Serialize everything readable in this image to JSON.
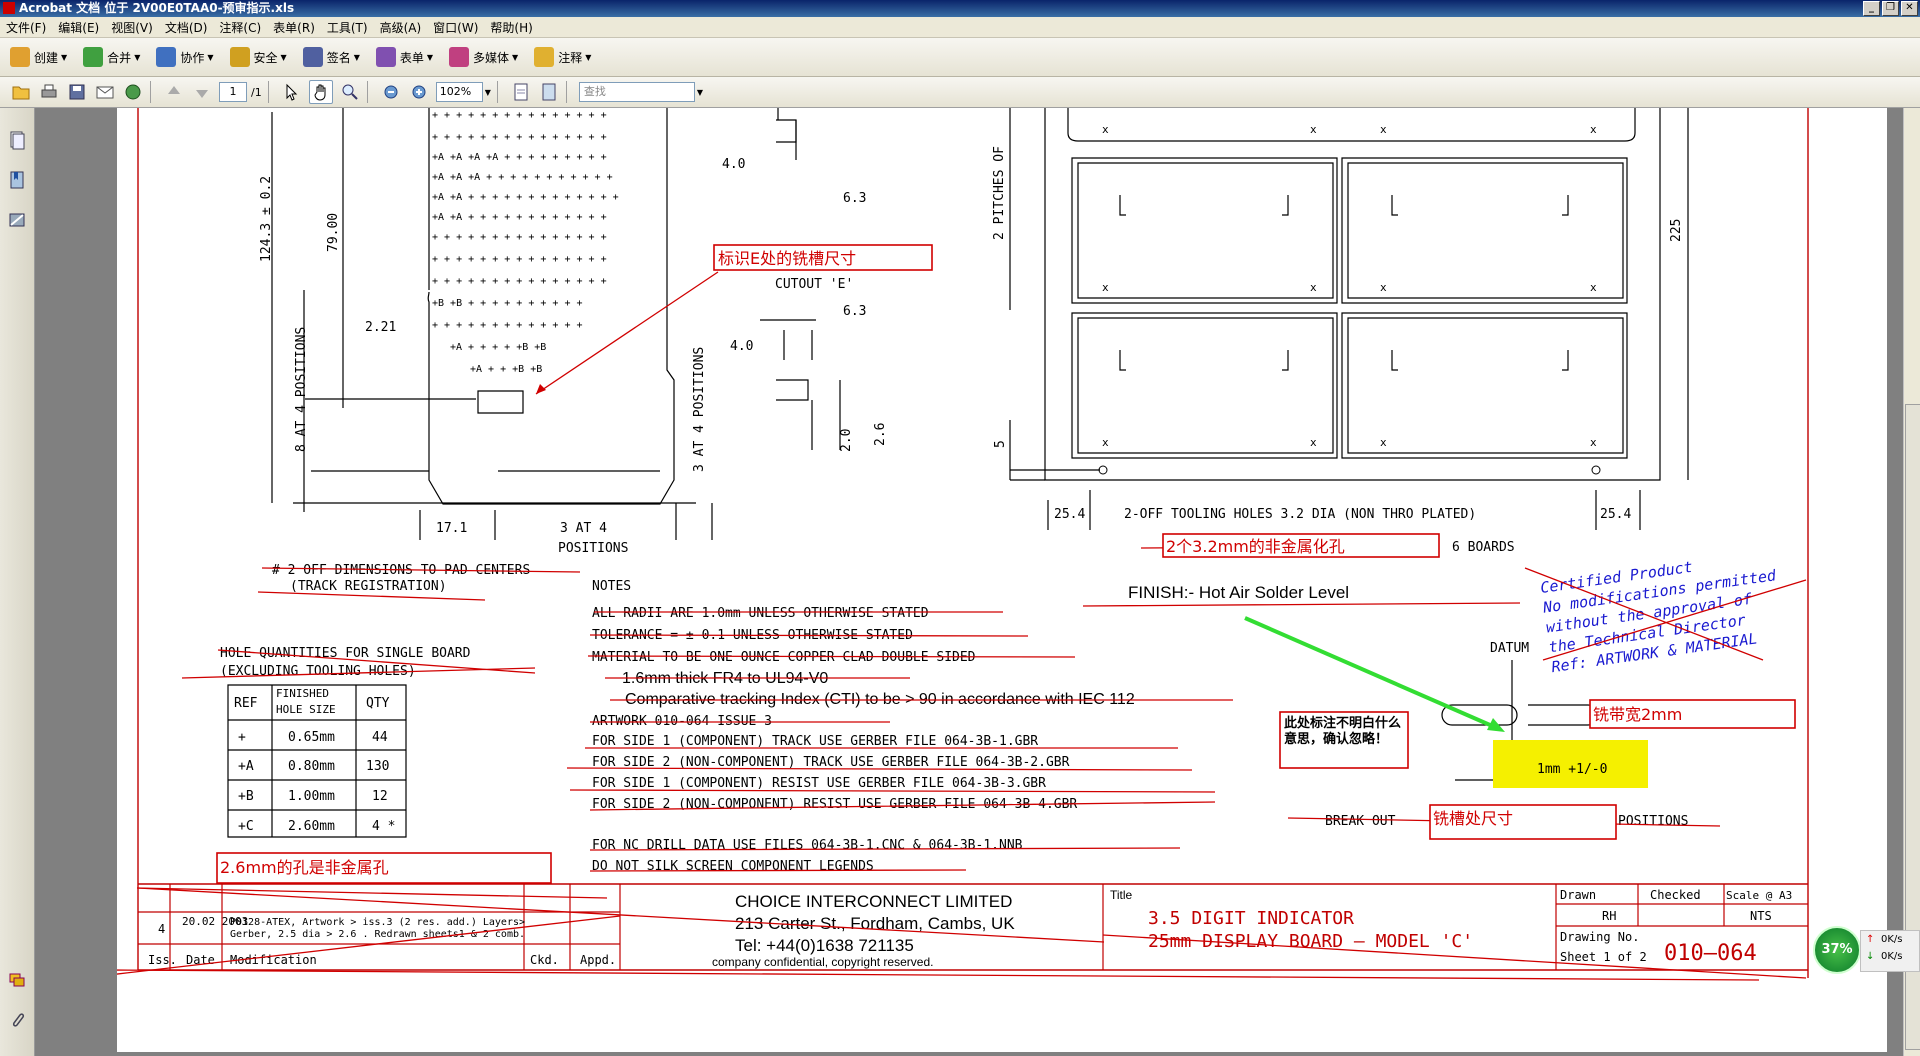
{
  "window": {
    "title": "Acrobat 文档 位于 2V00E0TAA0-预审指示.xls"
  },
  "menu": [
    "文件(F)",
    "编辑(E)",
    "视图(V)",
    "文档(D)",
    "注释(C)",
    "表单(R)",
    "工具(T)",
    "高级(A)",
    "窗口(W)",
    "帮助(H)"
  ],
  "toolbar": {
    "items": [
      {
        "label": "创建",
        "icon": "create-icon",
        "color": "#e0a030"
      },
      {
        "label": "合并",
        "icon": "combine-icon",
        "color": "#40a040"
      },
      {
        "label": "协作",
        "icon": "collaborate-icon",
        "color": "#4070c0"
      },
      {
        "label": "安全",
        "icon": "lock-icon",
        "color": "#d0a020"
      },
      {
        "label": "签名",
        "icon": "pen-icon",
        "color": "#5060a0"
      },
      {
        "label": "表单",
        "icon": "form-icon",
        "color": "#8050b0"
      },
      {
        "label": "多媒体",
        "icon": "media-icon",
        "color": "#c04080"
      },
      {
        "label": "注释",
        "icon": "comment-icon",
        "color": "#e0b030"
      }
    ],
    "page_current": "1",
    "page_total": "/1",
    "zoom": "102%",
    "find_placeholder": "查找"
  },
  "drawing": {
    "dims": {
      "d124": "124.3 ± 0.2",
      "d79": "79.00",
      "d221": "2.21",
      "d171": "17.1",
      "d40a": "4.0",
      "d63a": "6.3",
      "d63b": "6.3",
      "d40b": "4.0",
      "d20": "2.0",
      "d26": "2.6",
      "d225": "225",
      "d5": "5",
      "d254a": "25.4",
      "d254b": "25.4"
    },
    "labels": {
      "pos8": "8 AT 4 POSITIONS",
      "pos3v": "3 AT 4 POSITIONS",
      "pos3h1": "3 AT 4",
      "pos3h2": "POSITIONS",
      "cutout": "CUTOUT 'E'",
      "pitches": "2 PITCHES OF",
      "tooling": "2-OFF TOOLING HOLES 3.2 DIA (NON THRO PLATED)",
      "boards": "6 BOARDS",
      "pad1": "# 2 OFF DIMENSIONS TO PAD CENTERS",
      "pad2": "(TRACK REGISTRATION)",
      "hq1": "HOLE QUANTITIES FOR SINGLE BOARD",
      "hq2": "(EXCLUDING TOOLING HOLES)",
      "finish": "FINISH:-  Hot Air Solder Level",
      "datum": "DATUM",
      "dim1mm": "1mm  +1/-0",
      "breakout": "BREAK OUT",
      "positions": "POSITIONS"
    },
    "notes": [
      "NOTES",
      "ALL RADII ARE 1.0mm UNLESS OTHERWISE STATED",
      "TOLERANCE = ± 0.1 UNLESS OTHERWISE STATED",
      "MATERIAL TO BE ONE OUNCE COPPER CLAD DOUBLE SIDED",
      "1.6mm thick FR4 to UL94-V0",
      "Comparative tracking Index (CTI) to be > 90 in accordance with IEC 112",
      "ARTWORK 010-064    ISSUE 3",
      "FOR SIDE 1 (COMPONENT) TRACK USE GERBER FILE 064-3B-1.GBR",
      "FOR SIDE 2 (NON-COMPONENT) TRACK USE GERBER FILE 064-3B-2.GBR",
      "FOR SIDE 1 (COMPONENT) RESIST USE GERBER FILE 064-3B-3.GBR",
      "FOR SIDE 2 (NON-COMPONENT) RESIST USE GERBER FILE 064-3B-4.GBR",
      "FOR NC DRILL DATA USE FILES 064-3B-1.CNC & 064-3B-1.NNB",
      "DO NOT SILK SCREEN COMPONENT LEGENDS"
    ],
    "hole_table": {
      "headers": [
        "REF",
        "FINISHED",
        "HOLE SIZE",
        "QTY"
      ],
      "rows": [
        {
          "ref": "+",
          "size": "0.65mm",
          "qty": "44"
        },
        {
          "ref": "+A",
          "size": "0.80mm",
          "qty": "130"
        },
        {
          "ref": "+B",
          "size": "1.00mm",
          "qty": "12"
        },
        {
          "ref": "+C",
          "size": "2.60mm",
          "qty": "4 *"
        }
      ]
    },
    "certified": [
      "Certified Product",
      "No modifications permitted",
      "without the approval of",
      "the Technical Director",
      "Ref: ARTWORK & MATERIAL"
    ],
    "title_block": {
      "company": "CHOICE INTERCONNECT LIMITED",
      "address": "213 Carter St., Fordham, Cambs, UK",
      "tel": "Tel: +44(0)1638 721135",
      "confidential": "company confidential, copyright reserved.",
      "title_label": "Title",
      "title1": "3.5  DIGIT  INDICATOR",
      "title2": "25mm  DISPLAY  BOARD  —  MODEL  'C'",
      "drawn_label": "Drawn",
      "drawn": "RH",
      "checked_label": "Checked",
      "scale_label": "Scale @ A3",
      "scale": "NTS",
      "drawing_no_label": "Drawing No.",
      "sheet": "Sheet  1  of  2",
      "drawing_no": "010—064",
      "iss": "4",
      "date": "20.02 2003",
      "mod1": "P0128-ATEX, Artwork > iss.3 (2 res. add.) Layers>",
      "mod2": "Gerber, 2.5 dia > 2.6 . Redrawn sheets1 & 2 comb.",
      "h_iss": "Iss.",
      "h_date": "Date",
      "h_mod": "Modification",
      "h_ckd": "Ckd.",
      "h_appd": "Appd."
    }
  },
  "annotations": {
    "a1": "标识E处的铣槽尺寸",
    "a2": "2个3.2mm的非金属化孔",
    "a3": "铣带宽2mm",
    "a4": "铣槽处尺寸",
    "a5": "2.6mm的孔是非金属孔",
    "note": "此处标注不明白什么意思，确认忽略！"
  },
  "status": {
    "percent": "37%",
    "up": "0K/s",
    "down": "0K/s"
  }
}
